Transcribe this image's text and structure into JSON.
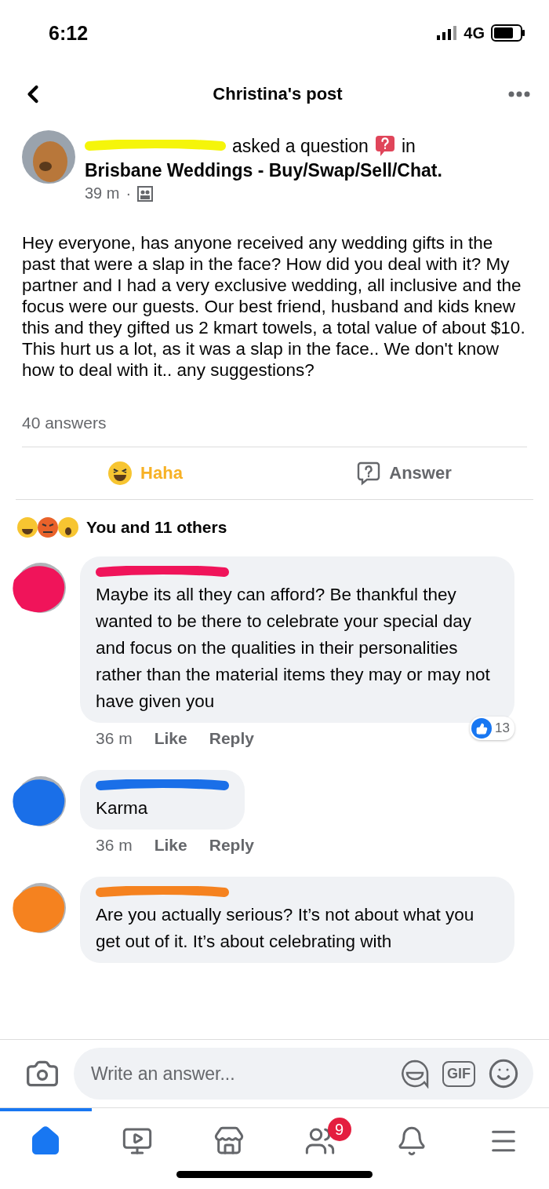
{
  "status_bar": {
    "time": "6:12",
    "network": "4G"
  },
  "header": {
    "title": "Christina's post"
  },
  "post": {
    "author": {
      "color": "#f5f50a"
    },
    "action": "asked a question",
    "in": "in",
    "group": "Brisbane Weddings - Buy/Swap/Sell/Chat.",
    "time": "39 m",
    "separator": "·",
    "body": "Hey everyone, has anyone received any wedding gifts in the past that were a slap in the face? How did you deal with it? My partner and I had a very exclusive wedding, all inclusive and the focus were our guests. Our best friend, husband and kids knew this and they gifted us 2 kmart towels, a total value of about $10. This hurt us a lot, as it was a slap in the face.. We don't know how to deal with it.. any suggestions?",
    "answers_count": "40 answers"
  },
  "actions": [
    {
      "kind": "reaction",
      "label": "Haha",
      "selected": true
    },
    {
      "kind": "answer",
      "label": "Answer",
      "selected": false
    }
  ],
  "reactions_summary": "You and 11 others",
  "comments": [
    {
      "color": "#f0145a",
      "text": "Maybe its all they can afford? Be thankful they wanted to be there to celebrate your special day and focus on the qualities in their personalities rather than the material items they may or may not have given you",
      "time": "36 m",
      "like": "Like",
      "reply": "Reply",
      "likes_count": "13"
    },
    {
      "color": "#1a6fe8",
      "text": "Karma",
      "time": "36 m",
      "like": "Like",
      "reply": "Reply"
    },
    {
      "color": "#f5821f",
      "text": "Are you actually serious? It’s not about what you get out of it. It’s about celebrating with"
    }
  ],
  "composer": {
    "placeholder": "Write an answer...",
    "gif_label": "GIF"
  },
  "nav": [
    {
      "kind": "home",
      "selected": true
    },
    {
      "kind": "watch",
      "selected": false
    },
    {
      "kind": "marketplace",
      "selected": false
    },
    {
      "kind": "groups",
      "selected": false,
      "badge": "9"
    },
    {
      "kind": "notifications",
      "selected": false
    },
    {
      "kind": "menu",
      "selected": false
    }
  ]
}
